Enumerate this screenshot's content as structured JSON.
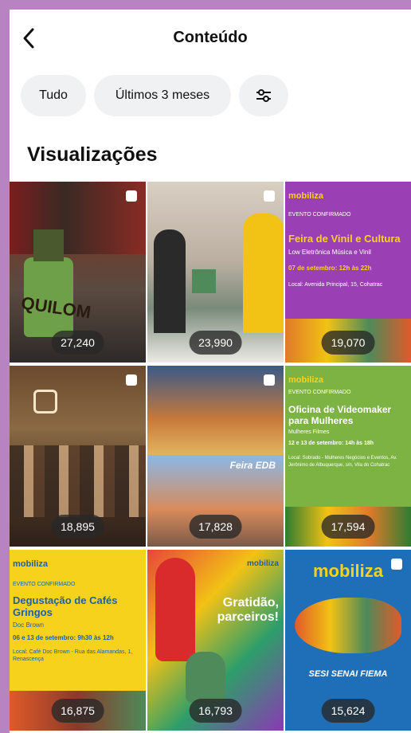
{
  "header": {
    "title": "Conteúdo",
    "back_icon": "chevron-left-icon"
  },
  "filters": {
    "all_label": "Tudo",
    "period_label": "Últimos 3 meses",
    "settings_icon": "sliders-icon"
  },
  "section": {
    "title": "Visualizações"
  },
  "posts": [
    {
      "views": "27,240",
      "caption": "QUILOM"
    },
    {
      "views": "23,990"
    },
    {
      "views": "19,070",
      "brand": "mobiliza",
      "badge": "EVENTO CONFIRMADO",
      "headline": "Feira de Vinil e Cultura",
      "sub": "Low Eletrônica Música e Vinil",
      "date": "07 de setembro: 12h às 22h",
      "place": "Local: Avenida Principal, 15, Cohatrac"
    },
    {
      "views": "18,895"
    },
    {
      "views": "17,828",
      "caption": "Feira EDB"
    },
    {
      "views": "17,594",
      "brand": "mobiliza",
      "badge": "EVENTO CONFIRMADO",
      "headline": "Oficina de Videomaker para Mulheres",
      "sub": "Mulheres Filmes",
      "date": "12 e 13 de setembro: 14h às 18h",
      "place": "Local: Sobrado - Mulheres Negócios e Eventos, Av. Jerônimo de Albuquerque, s/n, Vila do Cohatrac"
    },
    {
      "views": "16,875",
      "brand": "mobiliza",
      "badge": "EVENTO CONFIRMADO",
      "headline": "Degustação de Cafés Gringos",
      "sub": "Doc Brown",
      "date": "06 e 13 de setembro: 9h30 às 12h",
      "place": "Local: Café Doc Brown - Rua das Alamandas, 1, Renascença"
    },
    {
      "views": "16,793",
      "brand": "mobiliza",
      "headline": "Gratidão, parceiros!"
    },
    {
      "views": "15,624",
      "brand": "mobiliza",
      "sponsors": "SESI SENAI FIEMA"
    }
  ],
  "colors": {
    "frame": "#b784c1",
    "chip_bg": "#eff1f3",
    "purple_poster": "#9b3fb5",
    "green_poster": "#7cb342",
    "yellow_poster": "#f7d21d",
    "blue_poster": "#1f6fb8"
  }
}
